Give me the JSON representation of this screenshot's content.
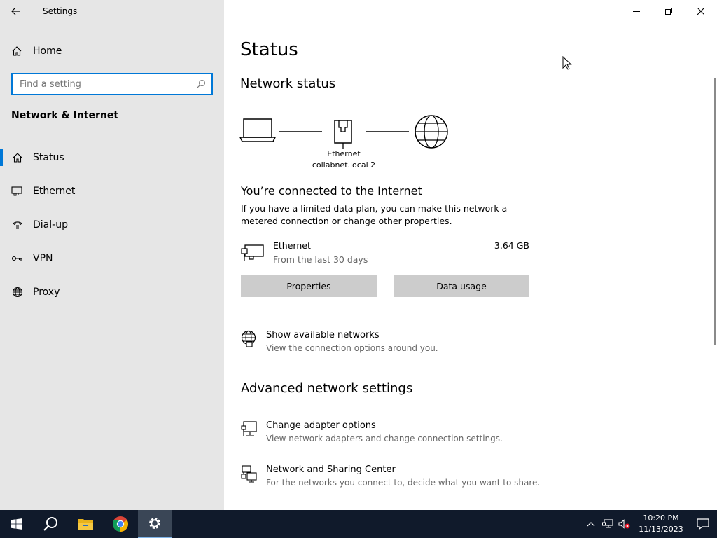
{
  "window": {
    "title": "Settings"
  },
  "sidebar": {
    "home_label": "Home",
    "search_placeholder": "Find a setting",
    "section_title": "Network & Internet",
    "items": [
      {
        "label": "Status",
        "icon": "home-status-icon",
        "active": true
      },
      {
        "label": "Ethernet",
        "icon": "ethernet-icon",
        "active": false
      },
      {
        "label": "Dial-up",
        "icon": "dialup-icon",
        "active": false
      },
      {
        "label": "VPN",
        "icon": "vpn-icon",
        "active": false
      },
      {
        "label": "Proxy",
        "icon": "globe-icon",
        "active": false
      }
    ]
  },
  "main": {
    "title": "Status",
    "network_status_heading": "Network status",
    "diagram": {
      "adapter_name": "Ethernet",
      "network_name": "collabnet.local 2"
    },
    "connected_title": "You’re connected to the Internet",
    "connected_desc": "If you have a limited data plan, you can make this network a metered connection or change other properties.",
    "usage": {
      "name": "Ethernet",
      "period": "From the last 30 days",
      "amount": "3.64 GB"
    },
    "buttons": {
      "properties": "Properties",
      "data_usage": "Data usage"
    },
    "show_networks": {
      "title": "Show available networks",
      "desc": "View the connection options around you."
    },
    "advanced_heading": "Advanced network settings",
    "adapter_options": {
      "title": "Change adapter options",
      "desc": "View network adapters and change connection settings."
    },
    "sharing_center": {
      "title": "Network and Sharing Center",
      "desc": "For the networks you connect to, decide what you want to share."
    }
  },
  "taskbar": {
    "time": "10:20 PM",
    "date": "11/13/2023"
  },
  "colors": {
    "accent": "#0078d7",
    "sidebar_bg": "#e6e6e6",
    "taskbar_bg": "#101a2b",
    "button_bg": "#cccccc"
  }
}
